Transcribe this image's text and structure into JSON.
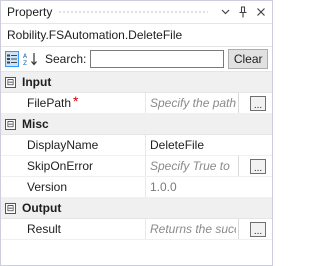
{
  "panel": {
    "title": "Property",
    "activity_name": "Robility.FSAutomation.DeleteFile"
  },
  "toolbar": {
    "search_label": "Search:",
    "search_value": "",
    "clear_label": "Clear"
  },
  "sections": {
    "input": {
      "label": "Input",
      "filepath": {
        "name": "FilePath",
        "required_mark": "*",
        "placeholder": "Specify the path"
      }
    },
    "misc": {
      "label": "Misc",
      "displayname": {
        "name": "DisplayName",
        "value": "DeleteFile"
      },
      "skiponerror": {
        "name": "SkipOnError",
        "placeholder": "Specify True to"
      },
      "version": {
        "name": "Version",
        "value": "1.0.0"
      }
    },
    "output": {
      "label": "Output",
      "result": {
        "name": "Result",
        "placeholder": "Returns the succ"
      }
    }
  },
  "ellipsis_label": "...",
  "expander_symbol": "⊟",
  "icons": {
    "dropdown": "chevron-down-icon",
    "pin": "pin-icon",
    "close": "close-icon",
    "categorized": "categorized-view-icon",
    "alphabetical": "alphabetical-sort-icon"
  }
}
